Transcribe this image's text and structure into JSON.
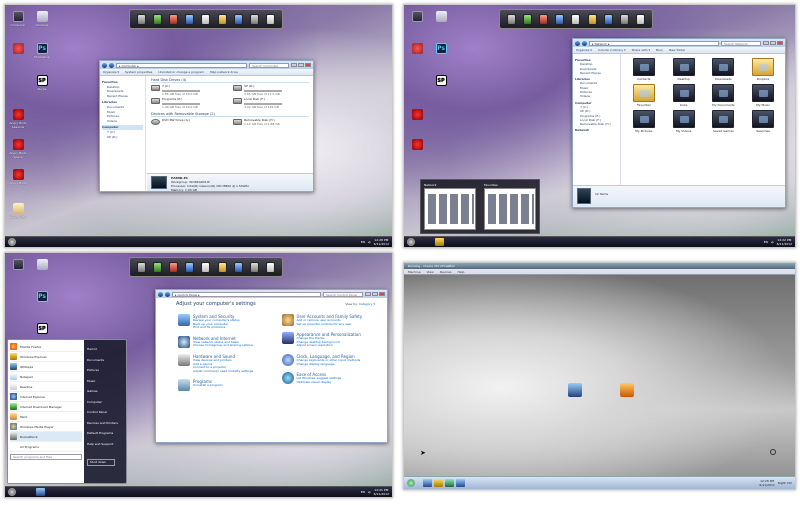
{
  "colors": {
    "accent": "#1e395b",
    "taskbar": "#0d0d1a",
    "link": "#0066cc"
  },
  "panel1": {
    "desktop_icons": [
      {
        "label": "Computer",
        "icon": "computer-icon"
      },
      {
        "label": "Photoshop",
        "icon": "photoshop-icon"
      },
      {
        "label": "",
        "icon": "app-icon"
      },
      {
        "label": "Skype",
        "icon": "sp-icon"
      },
      {
        "label": "Angry Birds Seasons",
        "icon": "bird-icon"
      },
      {
        "label": "Angry Birds Space",
        "icon": "bird-icon"
      },
      {
        "label": "Angry Birds",
        "icon": "bird-icon"
      },
      {
        "label": "Recycle Bin",
        "icon": "trash-icon"
      },
      {
        "label": "Libraries",
        "icon": "media-icon"
      }
    ],
    "window": {
      "address": "▸ Computer ▸",
      "search": "Search Computer",
      "toolbar": [
        "Organize ▾",
        "System properties",
        "Uninstall or change a program",
        "Map network drive"
      ],
      "sidebar": {
        "favorites": "Favorites",
        "fav_items": [
          "Desktop",
          "Downloads",
          "Recent Places"
        ],
        "libraries": "Libraries",
        "lib_items": [
          "Documents",
          "Music",
          "Pictures",
          "Videos"
        ],
        "computer": "Computer",
        "comp_items": [
          "7 (C:)",
          "XP (D:)"
        ]
      },
      "hdd_header": "Hard Disk Drives (4)",
      "drives": [
        {
          "name": "7 (C:)",
          "free": "1.85 GB free of 49.0 GB",
          "fill": 0.96,
          "red": true
        },
        {
          "name": "XP (D:)",
          "free": "3.65 GB free of 11.0 GB",
          "fill": 0.67,
          "red": false
        },
        {
          "name": "Programs (E:)",
          "free": "1.44 GB free of 49.0 GB",
          "fill": 0.97,
          "red": true
        },
        {
          "name": "Local Disk (F:)",
          "free": "3.02 GB free of 149 GB",
          "fill": 0.98,
          "red": true
        }
      ],
      "removable_header": "Devices with Removable Storage (2)",
      "removable": [
        {
          "name": "DVD RW Drive (G:)",
          "free": ""
        },
        {
          "name": "Removable Disk (H:)",
          "free": "1.12 GB free of 1.88 GB"
        }
      ],
      "details": {
        "name": "HAMID-PC",
        "workgroup": "Workgroup: WORKGROUP",
        "processor": "Processor: Intel(R) Celeron(R) CPU  B800 @ 1.50GHz",
        "memory": "Memory: 1.00 GB"
      }
    },
    "tray": {
      "lang": "EN",
      "time": "12:28 PM",
      "date": "6/11/2012"
    }
  },
  "panel2": {
    "window": {
      "address": "▸ Network ▸",
      "search": "Search Network",
      "toolbar": [
        "Organize ▾",
        "Include in library ▾",
        "Share with ▾",
        "Burn",
        "New folder"
      ],
      "sidebar": {
        "favorites": "Favorites",
        "fav_items": [
          "Desktop",
          "Downloads",
          "Recent Places"
        ],
        "libraries": "Libraries",
        "lib_items": [
          "Documents",
          "Music",
          "Pictures",
          "Videos"
        ],
        "computer": "Computer",
        "comp_items": [
          "7 (C:)",
          "XP (D:)",
          "Programs (E:)",
          "Local Disk (F:)",
          "Removable Disk (H:)"
        ],
        "network": "Network"
      },
      "folders": [
        {
          "label": "Contacts",
          "yellow": false
        },
        {
          "label": "Desktop",
          "yellow": false
        },
        {
          "label": "Downloads",
          "yellow": false
        },
        {
          "label": "Dropbox",
          "yellow": true
        },
        {
          "label": "Favorites",
          "yellow": true
        },
        {
          "label": "Links",
          "yellow": false
        },
        {
          "label": "My Documents",
          "yellow": false
        },
        {
          "label": "My Music",
          "yellow": false
        },
        {
          "label": "My Pictures",
          "yellow": false
        },
        {
          "label": "My Videos",
          "yellow": false
        },
        {
          "label": "Saved Games",
          "yellow": false
        },
        {
          "label": "Searches",
          "yellow": false
        }
      ],
      "status": "12 items"
    },
    "thumbs": [
      "Network",
      "Favorites"
    ],
    "tray": {
      "lang": "EN",
      "time": "12:22 PM",
      "date": "6/11/2012"
    }
  },
  "panel3": {
    "start_menu": {
      "programs": [
        "Mozilla Firefox",
        "Windows Explorer",
        "IDMApps",
        "Notepad",
        "Readme",
        "Internet Explorer",
        "Internet Download Manager",
        "Paint",
        "Windows Media Player",
        "RocketDock"
      ],
      "all_programs": "All Programs",
      "search_placeholder": "Search programs and files",
      "right": [
        "Hamid",
        "Documents",
        "Pictures",
        "Music",
        "Games",
        "Computer",
        "Control Panel",
        "Devices and Printers",
        "Default Programs",
        "Help and Support"
      ],
      "shutdown": "Shut down"
    },
    "control_panel": {
      "address": "▸ Control Panel ▸",
      "search": "Search Control Panel",
      "heading": "Adjust your computer's settings",
      "view_by_label": "View by:",
      "view_by_value": "Category ▾",
      "left": [
        {
          "title": "System and Security",
          "links": [
            "Review your computer's status",
            "Back up your computer",
            "Find and fix problems"
          ]
        },
        {
          "title": "Network and Internet",
          "links": [
            "View network status and tasks",
            "Choose homegroup and sharing options"
          ]
        },
        {
          "title": "Hardware and Sound",
          "links": [
            "View devices and printers",
            "Add a device",
            "Connect to a projector",
            "Adjust commonly used mobility settings"
          ]
        },
        {
          "title": "Programs",
          "links": [
            "Uninstall a program"
          ]
        }
      ],
      "right": [
        {
          "title": "User Accounts and Family Safety",
          "links": [
            "Add or remove user accounts",
            "Set up parental controls for any user"
          ]
        },
        {
          "title": "Appearance and Personalization",
          "links": [
            "Change the theme",
            "Change desktop background",
            "Adjust screen resolution"
          ]
        },
        {
          "title": "Clock, Language, and Region",
          "links": [
            "Change keyboards or other input methods",
            "Change display language"
          ]
        },
        {
          "title": "Ease of Access",
          "links": [
            "Let Windows suggest settings",
            "Optimize visual display"
          ]
        }
      ]
    },
    "tray": {
      "lang": "EN",
      "time": "12:21 PM",
      "date": "6/11/2012"
    }
  },
  "panel4": {
    "vm_title": "Running - Oracle VM VirtualBox",
    "vm_menu": [
      "Machine",
      "View",
      "Devices",
      "Help"
    ],
    "desktop_icons": [
      "",
      ""
    ],
    "tray": {
      "time": "12:28 PM",
      "date": "6/11/2012",
      "lang": "Right Ctrl"
    }
  }
}
